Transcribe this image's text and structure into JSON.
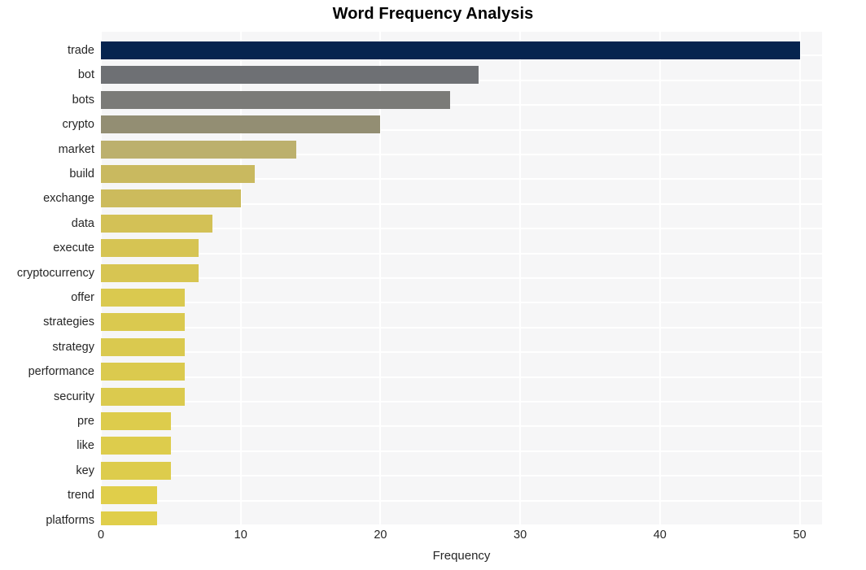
{
  "chart_data": {
    "type": "bar",
    "orientation": "horizontal",
    "title": "Word Frequency Analysis",
    "xlabel": "Frequency",
    "ylabel": "",
    "categories": [
      "trade",
      "bot",
      "bots",
      "crypto",
      "market",
      "build",
      "exchange",
      "data",
      "execute",
      "cryptocurrency",
      "offer",
      "strategies",
      "strategy",
      "performance",
      "security",
      "pre",
      "like",
      "key",
      "trend",
      "platforms"
    ],
    "values": [
      50,
      27,
      25,
      20,
      14,
      11,
      10,
      8,
      7,
      7,
      6,
      6,
      6,
      6,
      6,
      5,
      5,
      5,
      4,
      4
    ],
    "bar_colors": [
      "#06244f",
      "#6e7074",
      "#7b7b78",
      "#938e73",
      "#bcb06d",
      "#c9b95f",
      "#ccbb5c",
      "#d3c156",
      "#d6c453",
      "#d7c552",
      "#dac94f",
      "#dac94f",
      "#dac94f",
      "#dbca4e",
      "#dbca4e",
      "#ddcc4c",
      "#ddcc4c",
      "#ddcc4c",
      "#e0ce4a",
      "#e0ce4a"
    ],
    "xlim": [
      0,
      51.6
    ],
    "xticks": [
      0,
      10,
      20,
      30,
      40,
      50
    ],
    "xtick_labels": [
      "0",
      "10",
      "20",
      "30",
      "40",
      "50"
    ],
    "grid": true,
    "grid_color": "#ffffff",
    "plot_background": "#f6f6f7",
    "figure_background": "#ffffff",
    "legend": null
  }
}
